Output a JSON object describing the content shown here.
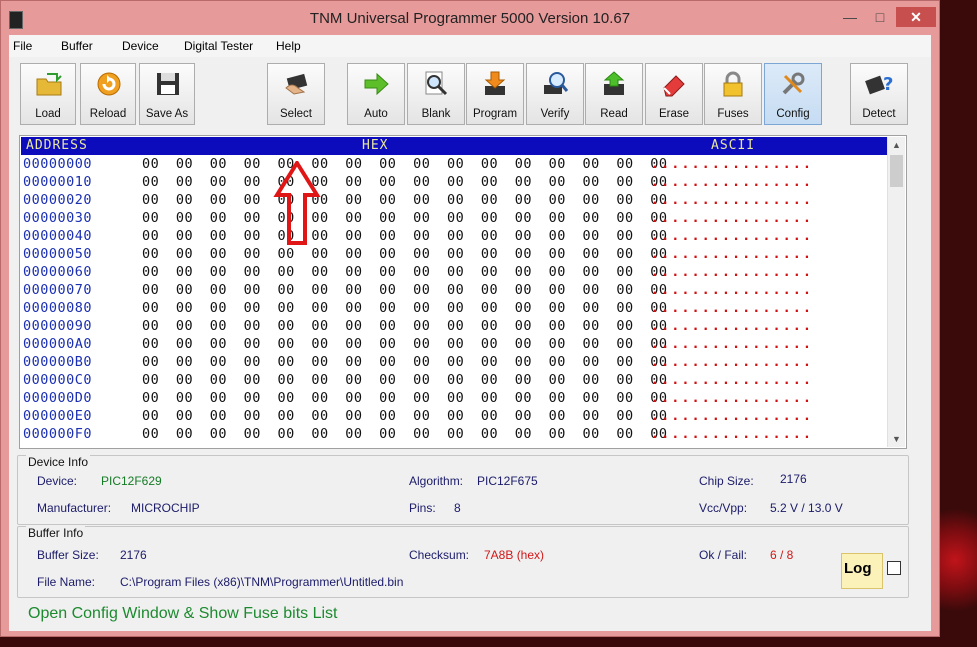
{
  "window": {
    "title": "TNM  Universal Programmer 5000   Version 10.67",
    "min": "—",
    "max": "□",
    "close": "✕"
  },
  "menu": [
    "File",
    "Buffer",
    "Device",
    "Digital Tester",
    "Help"
  ],
  "toolbar": [
    {
      "label": "Load",
      "icon": "folder-load-icon"
    },
    {
      "label": "Reload",
      "icon": "reload-icon"
    },
    {
      "label": "Save As",
      "icon": "floppy-icon"
    },
    {
      "label": "Select",
      "icon": "chip-hand-icon"
    },
    {
      "label": "Auto",
      "icon": "arrow-right-icon"
    },
    {
      "label": "Blank",
      "icon": "magnifier-icon"
    },
    {
      "label": "Program",
      "icon": "download-chip-icon"
    },
    {
      "label": "Verify",
      "icon": "verify-icon"
    },
    {
      "label": "Read",
      "icon": "read-chip-icon"
    },
    {
      "label": "Erase",
      "icon": "eraser-icon"
    },
    {
      "label": "Fuses",
      "icon": "lock-icon"
    },
    {
      "label": "Config",
      "icon": "tools-icon"
    },
    {
      "label": "Detect",
      "icon": "detect-chip-icon"
    }
  ],
  "hex": {
    "headers": {
      "address": "ADDRESS",
      "hex": "HEX",
      "ascii": "ASCII"
    },
    "rows": [
      {
        "addr": "00000000",
        "hex": "00 00 00 00 00 00 00 00 00 00 00 00 00 00 00 00",
        "ascii": "................"
      },
      {
        "addr": "00000010",
        "hex": "00 00 00 00 00 00 00 00 00 00 00 00 00 00 00 00",
        "ascii": "................"
      },
      {
        "addr": "00000020",
        "hex": "00 00 00 00 00 00 00 00 00 00 00 00 00 00 00 00",
        "ascii": "................"
      },
      {
        "addr": "00000030",
        "hex": "00 00 00 00 00 00 00 00 00 00 00 00 00 00 00 00",
        "ascii": "................"
      },
      {
        "addr": "00000040",
        "hex": "00 00 00 00 00 00 00 00 00 00 00 00 00 00 00 00",
        "ascii": "................"
      },
      {
        "addr": "00000050",
        "hex": "00 00 00 00 00 00 00 00 00 00 00 00 00 00 00 00",
        "ascii": "................"
      },
      {
        "addr": "00000060",
        "hex": "00 00 00 00 00 00 00 00 00 00 00 00 00 00 00 00",
        "ascii": "................"
      },
      {
        "addr": "00000070",
        "hex": "00 00 00 00 00 00 00 00 00 00 00 00 00 00 00 00",
        "ascii": "................"
      },
      {
        "addr": "00000080",
        "hex": "00 00 00 00 00 00 00 00 00 00 00 00 00 00 00 00",
        "ascii": "................"
      },
      {
        "addr": "00000090",
        "hex": "00 00 00 00 00 00 00 00 00 00 00 00 00 00 00 00",
        "ascii": "................"
      },
      {
        "addr": "000000A0",
        "hex": "00 00 00 00 00 00 00 00 00 00 00 00 00 00 00 00",
        "ascii": "................"
      },
      {
        "addr": "000000B0",
        "hex": "00 00 00 00 00 00 00 00 00 00 00 00 00 00 00 00",
        "ascii": "................"
      },
      {
        "addr": "000000C0",
        "hex": "00 00 00 00 00 00 00 00 00 00 00 00 00 00 00 00",
        "ascii": "................"
      },
      {
        "addr": "000000D0",
        "hex": "00 00 00 00 00 00 00 00 00 00 00 00 00 00 00 00",
        "ascii": "................"
      },
      {
        "addr": "000000E0",
        "hex": "00 00 00 00 00 00 00 00 00 00 00 00 00 00 00 00",
        "ascii": "................"
      },
      {
        "addr": "000000F0",
        "hex": "00 00 00 00 00 00 00 00 00 00 00 00 00 00 00 00",
        "ascii": "................"
      }
    ]
  },
  "device_info": {
    "title": "Device Info",
    "device_label": "Device:",
    "device": "PIC12F629",
    "algorithm_label": "Algorithm:",
    "algorithm": "PIC12F675",
    "chip_size_label": "Chip Size:",
    "chip_size": "2176",
    "manufacturer_label": "Manufacturer:",
    "manufacturer": "MICROCHIP",
    "pins_label": "Pins:",
    "pins": "8",
    "vcc_label": "Vcc/Vpp:",
    "vcc": "5.2 V / 13.0 V"
  },
  "buffer_info": {
    "title": "Buffer Info",
    "size_label": "Buffer Size:",
    "size": "2176",
    "checksum_label": "Checksum:",
    "checksum": "7A8B (hex)",
    "okfail_label": "Ok / Fail:",
    "okfail": "6 / 8",
    "filename_label": "File Name:",
    "filename": "C:\\Program Files (x86)\\TNM\\Programmer\\Untitled.bin"
  },
  "log": {
    "label": "Log",
    "checked": false
  },
  "status": "Open Config Window & Show Fuse bits List",
  "colors": {
    "title_bar": "#e79a9a",
    "hex_header": "#0c0cbc",
    "address": "#1a2fb3",
    "ascii": "#d21010",
    "status": "#1c8a2f"
  }
}
